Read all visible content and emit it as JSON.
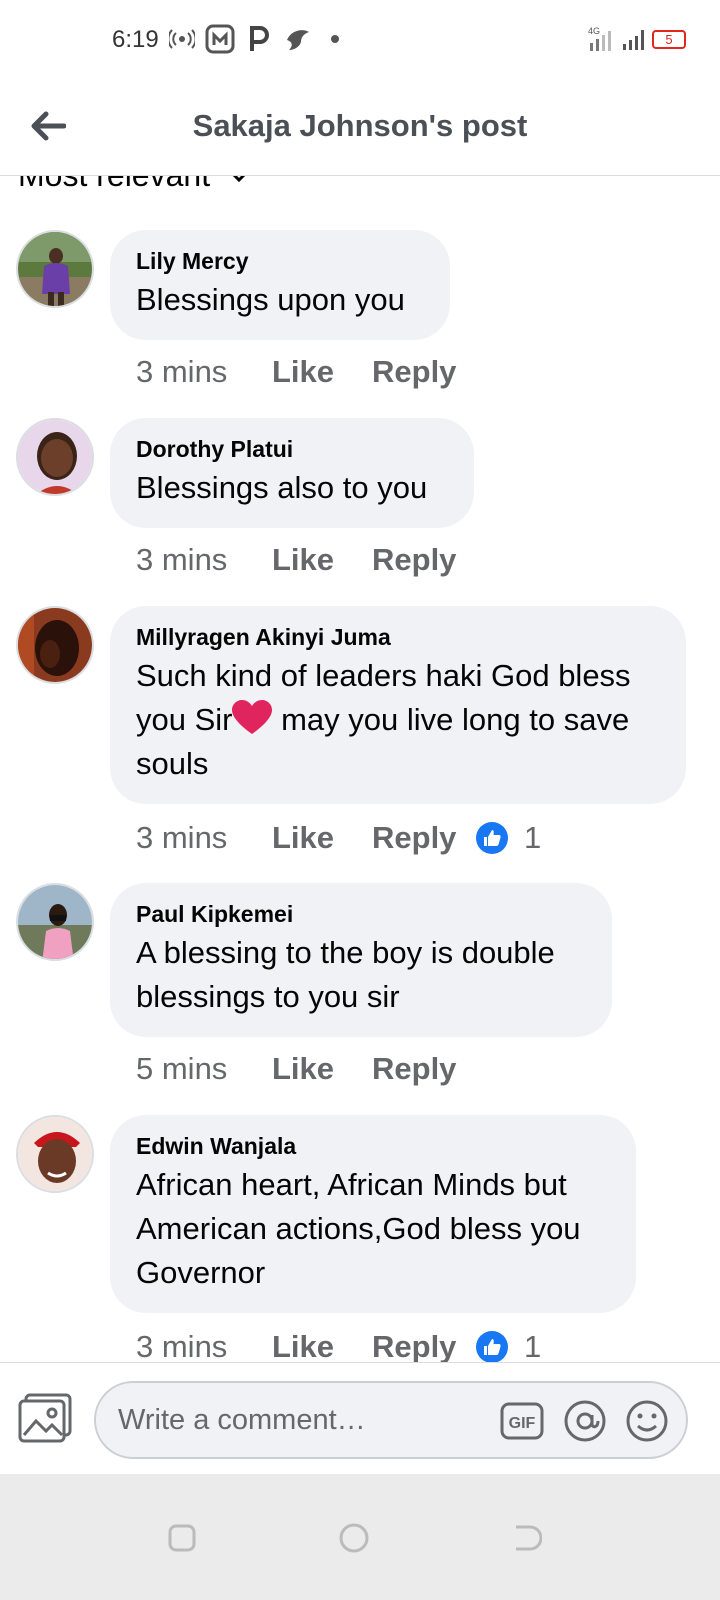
{
  "status_bar": {
    "time": "6:19",
    "network_label": "4G",
    "battery_level": "5"
  },
  "header": {
    "title": "Sakaja Johnson's post"
  },
  "sort": {
    "label": "Most relevant"
  },
  "comments": [
    {
      "name": "Lily Mercy",
      "lines": [
        "Blessings upon you"
      ],
      "time": "3 mins",
      "like_label": "Like",
      "reply_label": "Reply",
      "reaction_count": null
    },
    {
      "name": "Dorothy Platui",
      "lines": [
        "Blessings also to you"
      ],
      "time": "3 mins",
      "like_label": "Like",
      "reply_label": "Reply",
      "reaction_count": null
    },
    {
      "name": "Millyragen Akinyi Juma",
      "lines": [
        "Such kind of leaders haki God bless",
        "you Sir",
        "may you live long to save",
        "souls"
      ],
      "time": "3 mins",
      "like_label": "Like",
      "reply_label": "Reply",
      "reaction_count": "1"
    },
    {
      "name": "Paul Kipkemei",
      "lines": [
        "A blessing to the boy is double",
        "blessings to you sir"
      ],
      "time": "5 mins",
      "like_label": "Like",
      "reply_label": "Reply",
      "reaction_count": null
    },
    {
      "name": "Edwin Wanjala",
      "lines": [
        "African heart, African Minds but",
        "American actions,God bless you",
        "Governor"
      ],
      "time": "3 mins",
      "like_label": "Like",
      "reply_label": "Reply",
      "reaction_count": "1"
    }
  ],
  "composer": {
    "placeholder": "Write a comment…",
    "gif_label": "GIF"
  },
  "colors": {
    "bubble": "#f0f2f5",
    "secondary_text": "#65676b",
    "accent": "#1877f2",
    "heart": "#e0245e",
    "battery_warning": "#e0271c"
  },
  "icons": [
    "back-arrow-icon",
    "hotspot-icon",
    "app-notification-icon",
    "parking-icon",
    "bird-icon",
    "signal-icon",
    "battery-icon",
    "chevron-down-icon",
    "like-icon",
    "heart-emoji-icon",
    "photo-icon",
    "gif-icon",
    "at-icon",
    "emoji-icon"
  ]
}
